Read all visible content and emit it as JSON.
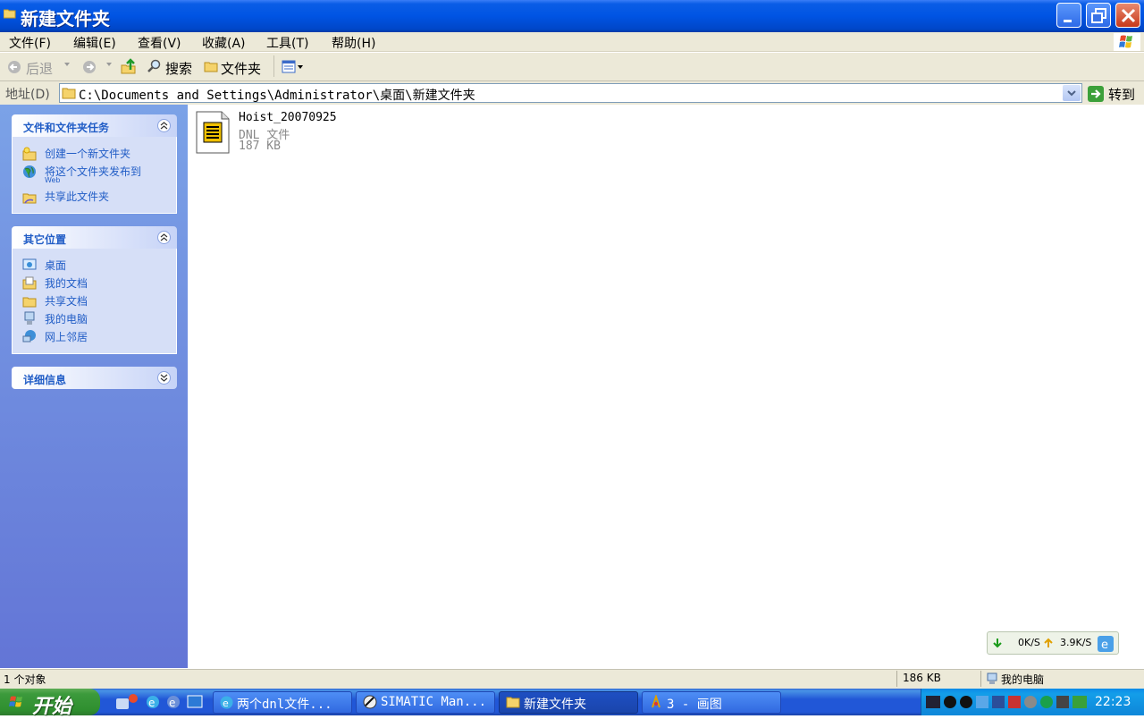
{
  "window": {
    "title": "新建文件夹"
  },
  "menu": {
    "items": [
      "文件(F)",
      "编辑(E)",
      "查看(V)",
      "收藏(A)",
      "工具(T)",
      "帮助(H)"
    ]
  },
  "toolbar": {
    "back": "后退",
    "search": "搜索",
    "folders": "文件夹"
  },
  "address": {
    "label": "地址(D)",
    "path": "C:\\Documents and Settings\\Administrator\\桌面\\新建文件夹",
    "go": "转到"
  },
  "sidebar": {
    "tasks": {
      "title": "文件和文件夹任务",
      "items": [
        {
          "label": "创建一个新文件夹",
          "icon": "new-folder-icon"
        },
        {
          "label": "将这个文件夹发布到",
          "sub": "Web",
          "icon": "globe-icon"
        },
        {
          "label": "共享此文件夹",
          "icon": "share-folder-icon"
        }
      ]
    },
    "places": {
      "title": "其它位置",
      "items": [
        {
          "label": "桌面",
          "icon": "desktop-icon"
        },
        {
          "label": "我的文档",
          "icon": "my-documents-icon"
        },
        {
          "label": "共享文档",
          "icon": "shared-documents-icon"
        },
        {
          "label": "我的电脑",
          "icon": "my-computer-icon"
        },
        {
          "label": "网上邻居",
          "icon": "network-icon"
        }
      ]
    },
    "details": {
      "title": "详细信息"
    }
  },
  "files": [
    {
      "name": "Hoist_20070925",
      "type": "DNL 文件",
      "size": "187 KB"
    }
  ],
  "speed": {
    "down": "0K/S",
    "up": "3.9K/S"
  },
  "status": {
    "count": "1 个对象",
    "size": "186 KB",
    "location": "我的电脑"
  },
  "taskbar": {
    "start": "开始",
    "buttons": [
      "两个dnl文件...",
      "SIMATIC Man...",
      "新建文件夹",
      "3 - 画图"
    ],
    "active": 2,
    "clock": "22:23"
  },
  "colors": {
    "titlebar": "#0054e3",
    "sidebar": "#7ba2e7",
    "link": "#215dc6",
    "taskbar": "#2157d7",
    "start": "#3c9a3c"
  }
}
